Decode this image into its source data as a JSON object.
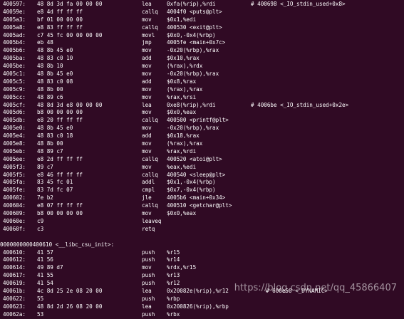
{
  "lines": [
    {
      "addr": "400597:",
      "bytes": "48 8d 3d fa 00 00 00",
      "mnem": "lea",
      "ops": "0xfa(%rip),%rdi",
      "cmt": "# 400698 <_IO_stdin_used+0x8>"
    },
    {
      "addr": "40059e:",
      "bytes": "e8 4d ff ff ff",
      "mnem": "callq",
      "ops": "4004f0 <puts@plt>",
      "cmt": ""
    },
    {
      "addr": "4005a3:",
      "bytes": "bf 01 00 00 00",
      "mnem": "mov",
      "ops": "$0x1,%edi",
      "cmt": ""
    },
    {
      "addr": "4005a8:",
      "bytes": "e8 83 ff ff ff",
      "mnem": "callq",
      "ops": "400530 <exit@plt>",
      "cmt": ""
    },
    {
      "addr": "4005ad:",
      "bytes": "c7 45 fc 00 00 00 00",
      "mnem": "movl",
      "ops": "$0x0,-0x4(%rbp)",
      "cmt": ""
    },
    {
      "addr": "4005b4:",
      "bytes": "eb 48",
      "mnem": "jmp",
      "ops": "4005fe <main+0x7c>",
      "cmt": ""
    },
    {
      "addr": "4005b6:",
      "bytes": "48 8b 45 e0",
      "mnem": "mov",
      "ops": "-0x20(%rbp),%rax",
      "cmt": ""
    },
    {
      "addr": "4005ba:",
      "bytes": "48 83 c0 10",
      "mnem": "add",
      "ops": "$0x10,%rax",
      "cmt": ""
    },
    {
      "addr": "4005be:",
      "bytes": "48 8b 10",
      "mnem": "mov",
      "ops": "(%rax),%rdx",
      "cmt": ""
    },
    {
      "addr": "4005c1:",
      "bytes": "48 8b 45 e0",
      "mnem": "mov",
      "ops": "-0x20(%rbp),%rax",
      "cmt": ""
    },
    {
      "addr": "4005c5:",
      "bytes": "48 83 c0 08",
      "mnem": "add",
      "ops": "$0x8,%rax",
      "cmt": ""
    },
    {
      "addr": "4005c9:",
      "bytes": "48 8b 00",
      "mnem": "mov",
      "ops": "(%rax),%rax",
      "cmt": ""
    },
    {
      "addr": "4005cc:",
      "bytes": "48 89 c6",
      "mnem": "mov",
      "ops": "%rax,%rsi",
      "cmt": ""
    },
    {
      "addr": "4005cf:",
      "bytes": "48 8d 3d e8 00 00 00",
      "mnem": "lea",
      "ops": "0xe8(%rip),%rdi",
      "cmt": "# 4006be <_IO_stdin_used+0x2e>"
    },
    {
      "addr": "4005d6:",
      "bytes": "b8 00 00 00 00",
      "mnem": "mov",
      "ops": "$0x0,%eax",
      "cmt": ""
    },
    {
      "addr": "4005db:",
      "bytes": "e8 20 ff ff ff",
      "mnem": "callq",
      "ops": "400500 <printf@plt>",
      "cmt": ""
    },
    {
      "addr": "4005e0:",
      "bytes": "48 8b 45 e0",
      "mnem": "mov",
      "ops": "-0x20(%rbp),%rax",
      "cmt": ""
    },
    {
      "addr": "4005e4:",
      "bytes": "48 83 c0 18",
      "mnem": "add",
      "ops": "$0x18,%rax",
      "cmt": ""
    },
    {
      "addr": "4005e8:",
      "bytes": "48 8b 00",
      "mnem": "mov",
      "ops": "(%rax),%rax",
      "cmt": ""
    },
    {
      "addr": "4005eb:",
      "bytes": "48 89 c7",
      "mnem": "mov",
      "ops": "%rax,%rdi",
      "cmt": ""
    },
    {
      "addr": "4005ee:",
      "bytes": "e8 2d ff ff ff",
      "mnem": "callq",
      "ops": "400520 <atoi@plt>",
      "cmt": ""
    },
    {
      "addr": "4005f3:",
      "bytes": "89 c7",
      "mnem": "mov",
      "ops": "%eax,%edi",
      "cmt": ""
    },
    {
      "addr": "4005f5:",
      "bytes": "e8 46 ff ff ff",
      "mnem": "callq",
      "ops": "400540 <sleep@plt>",
      "cmt": ""
    },
    {
      "addr": "4005fa:",
      "bytes": "83 45 fc 01",
      "mnem": "addl",
      "ops": "$0x1,-0x4(%rbp)",
      "cmt": ""
    },
    {
      "addr": "4005fe:",
      "bytes": "83 7d fc 07",
      "mnem": "cmpl",
      "ops": "$0x7,-0x4(%rbp)",
      "cmt": ""
    },
    {
      "addr": "400602:",
      "bytes": "7e b2",
      "mnem": "jle",
      "ops": "4005b6 <main+0x34>",
      "cmt": ""
    },
    {
      "addr": "400604:",
      "bytes": "e8 07 ff ff ff",
      "mnem": "callq",
      "ops": "400510 <getchar@plt>",
      "cmt": ""
    },
    {
      "addr": "400609:",
      "bytes": "b8 00 00 00 00",
      "mnem": "mov",
      "ops": "$0x0,%eax",
      "cmt": ""
    },
    {
      "addr": "40060e:",
      "bytes": "c9",
      "mnem": "leaveq",
      "ops": "",
      "cmt": ""
    },
    {
      "addr": "40060f:",
      "bytes": "c3",
      "mnem": "retq",
      "ops": "",
      "cmt": ""
    }
  ],
  "blank_line": "",
  "section_header": "0000000000400610 <__libc_csu_init>:",
  "lines2": [
    {
      "addr": "400610:",
      "bytes": "41 57",
      "mnem": "push",
      "ops": "%r15",
      "cmt": ""
    },
    {
      "addr": "400612:",
      "bytes": "41 56",
      "mnem": "push",
      "ops": "%r14",
      "cmt": ""
    },
    {
      "addr": "400614:",
      "bytes": "49 89 d7",
      "mnem": "mov",
      "ops": "%rdx,%r15",
      "cmt": ""
    },
    {
      "addr": "400617:",
      "bytes": "41 55",
      "mnem": "push",
      "ops": "%r13",
      "cmt": ""
    },
    {
      "addr": "400619:",
      "bytes": "41 54",
      "mnem": "push",
      "ops": "%r12",
      "cmt": ""
    },
    {
      "addr": "40061b:",
      "bytes": "4c 8d 25 2e 08 20 00",
      "mnem": "lea",
      "ops": "0x20082e(%rip),%r12",
      "cmt": "# 600e50 <_DYNAMIC>"
    },
    {
      "addr": "400622:",
      "bytes": "55",
      "mnem": "push",
      "ops": "%rbp",
      "cmt": ""
    },
    {
      "addr": "400623:",
      "bytes": "48 8d 2d 26 08 20 00",
      "mnem": "lea",
      "ops": "0x200826(%rip),%rbp",
      "cmt": ""
    },
    {
      "addr": "40062a:",
      "bytes": "53",
      "mnem": "push",
      "ops": "%rbx",
      "cmt": ""
    }
  ],
  "watermark": "https://blog.csdn.net/qq_45866407"
}
